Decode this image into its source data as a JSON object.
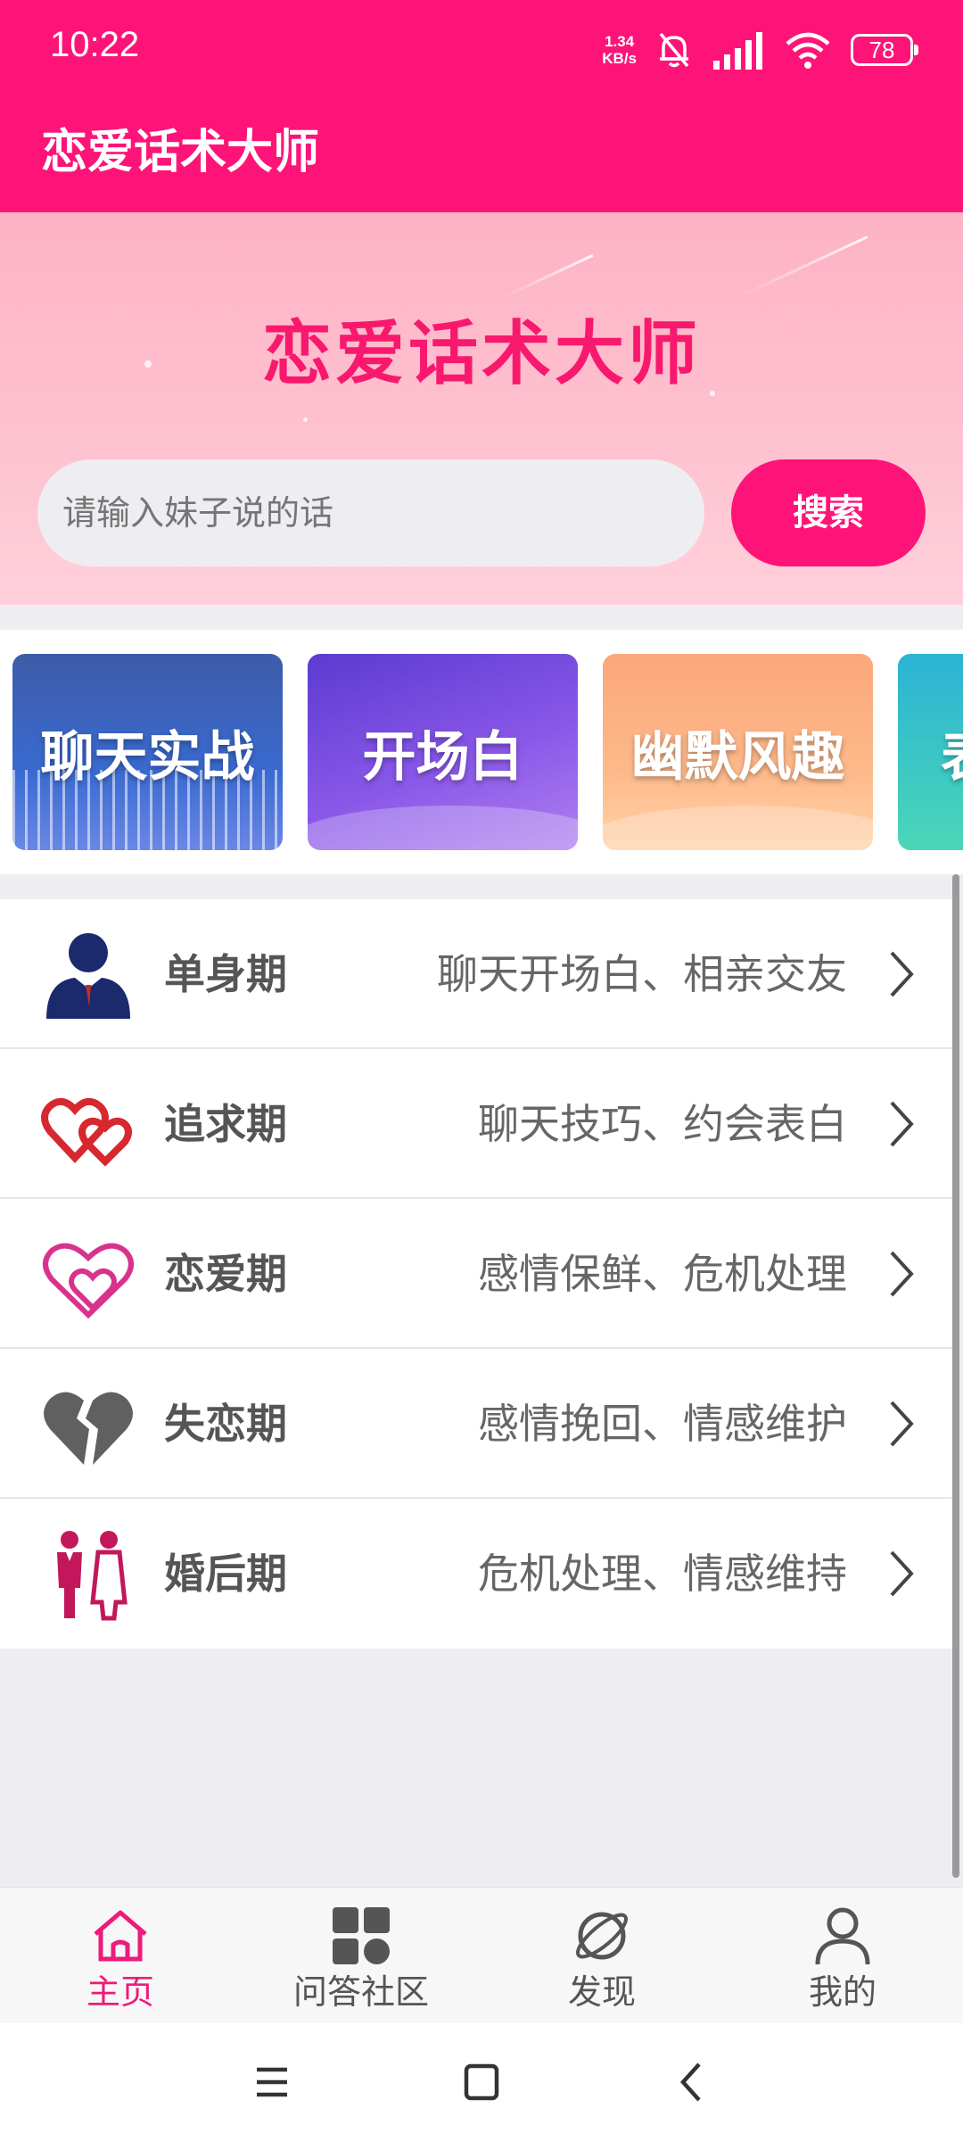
{
  "status_bar": {
    "time": "10:22",
    "speed_value": "1.34",
    "speed_unit": "KB/s",
    "battery": "78"
  },
  "app_bar": {
    "title": "恋爱话术大师"
  },
  "banner": {
    "title": "恋爱话术大师",
    "search_placeholder": "请输入妹子说的话",
    "search_button": "搜索"
  },
  "categories": [
    {
      "label": "聊天实战"
    },
    {
      "label": "开场白"
    },
    {
      "label": "幽默风趣"
    },
    {
      "label": "表"
    }
  ],
  "stages": [
    {
      "name": "单身期",
      "desc": "聊天开场白、相亲交友",
      "icon": "single-man-icon"
    },
    {
      "name": "追求期",
      "desc": "聊天技巧、约会表白",
      "icon": "double-heart-red-icon"
    },
    {
      "name": "恋爱期",
      "desc": "感情保鲜、危机处理",
      "icon": "double-heart-pink-icon"
    },
    {
      "name": "失恋期",
      "desc": "感情挽回、情感维护",
      "icon": "broken-heart-icon"
    },
    {
      "name": "婚后期",
      "desc": "危机处理、情感维持",
      "icon": "couple-icon"
    }
  ],
  "bottom_nav": [
    {
      "label": "主页",
      "icon": "home-icon",
      "active": true
    },
    {
      "label": "问答社区",
      "icon": "grid-icon",
      "active": false
    },
    {
      "label": "发现",
      "icon": "planet-icon",
      "active": false
    },
    {
      "label": "我的",
      "icon": "person-icon",
      "active": false
    }
  ],
  "colors": {
    "primary": "#fe1478",
    "banner_bg": "#fdb3c5",
    "active_tab": "#ef1a7a"
  }
}
